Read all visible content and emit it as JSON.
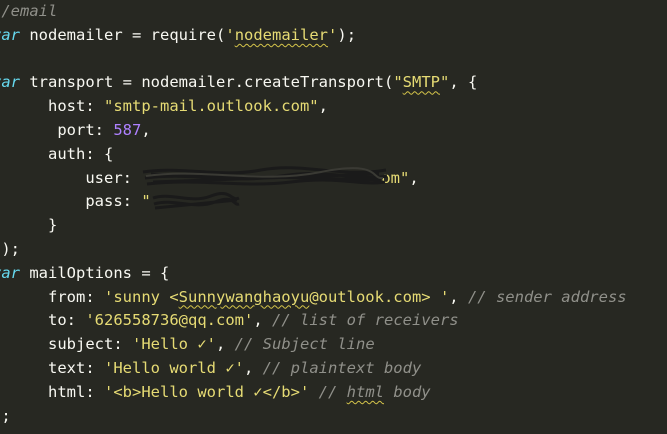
{
  "editor": {
    "lines": [
      {
        "id": "l1"
      },
      {
        "id": "l2"
      }
    ],
    "comment_email": "//email",
    "kw_var": "var",
    "ident_nodemailer": "nodemailer",
    "op_assign": " = ",
    "fn_require": "require",
    "str_q": "'",
    "str_nodemailer": "nodemailer",
    "pun_close_semi": ");",
    "ident_transport": "transport",
    "fn_create": "nodemailer.createTransport(",
    "str_dq": "\"",
    "str_smtp": "SMTP",
    "pun_comma_brace": ", {",
    "prop_host": "host",
    "str_host": "\"smtp-mail.outlook.com\"",
    "prop_port": "port",
    "num_port": "587",
    "prop_auth": "auth",
    "prop_user": "user",
    "user_tail": "om\"",
    "prop_pass": "pass",
    "pun_brace_close": "}",
    "pun_block_close": "});",
    "ident_mailOptions": "mailOptions",
    "pun_open_brace": " = {",
    "prop_from": "from",
    "str_from_a": "'sunny <",
    "str_from_b": "Sunnywanghaoyu",
    "str_from_c": "@outlook.com> '",
    "cm_from": "// sender address",
    "prop_to": "to",
    "str_to": "'626558736@qq.com'",
    "cm_to": "// list of receivers",
    "prop_subject": "subject",
    "str_subject": "'Hello ✓'",
    "cm_subject": "// Subject line",
    "prop_text": "text",
    "str_text": "'Hello world ✓'",
    "cm_text": "// plaintext body",
    "prop_html": "html",
    "str_html": "'<b>Hello world ✓</b>'",
    "cm_html_a": "// ",
    "cm_html_b": "html",
    "cm_html_c": " body",
    "pun_final": "};",
    "colon": ": ",
    "comma": ",",
    "comma_space": ", "
  }
}
